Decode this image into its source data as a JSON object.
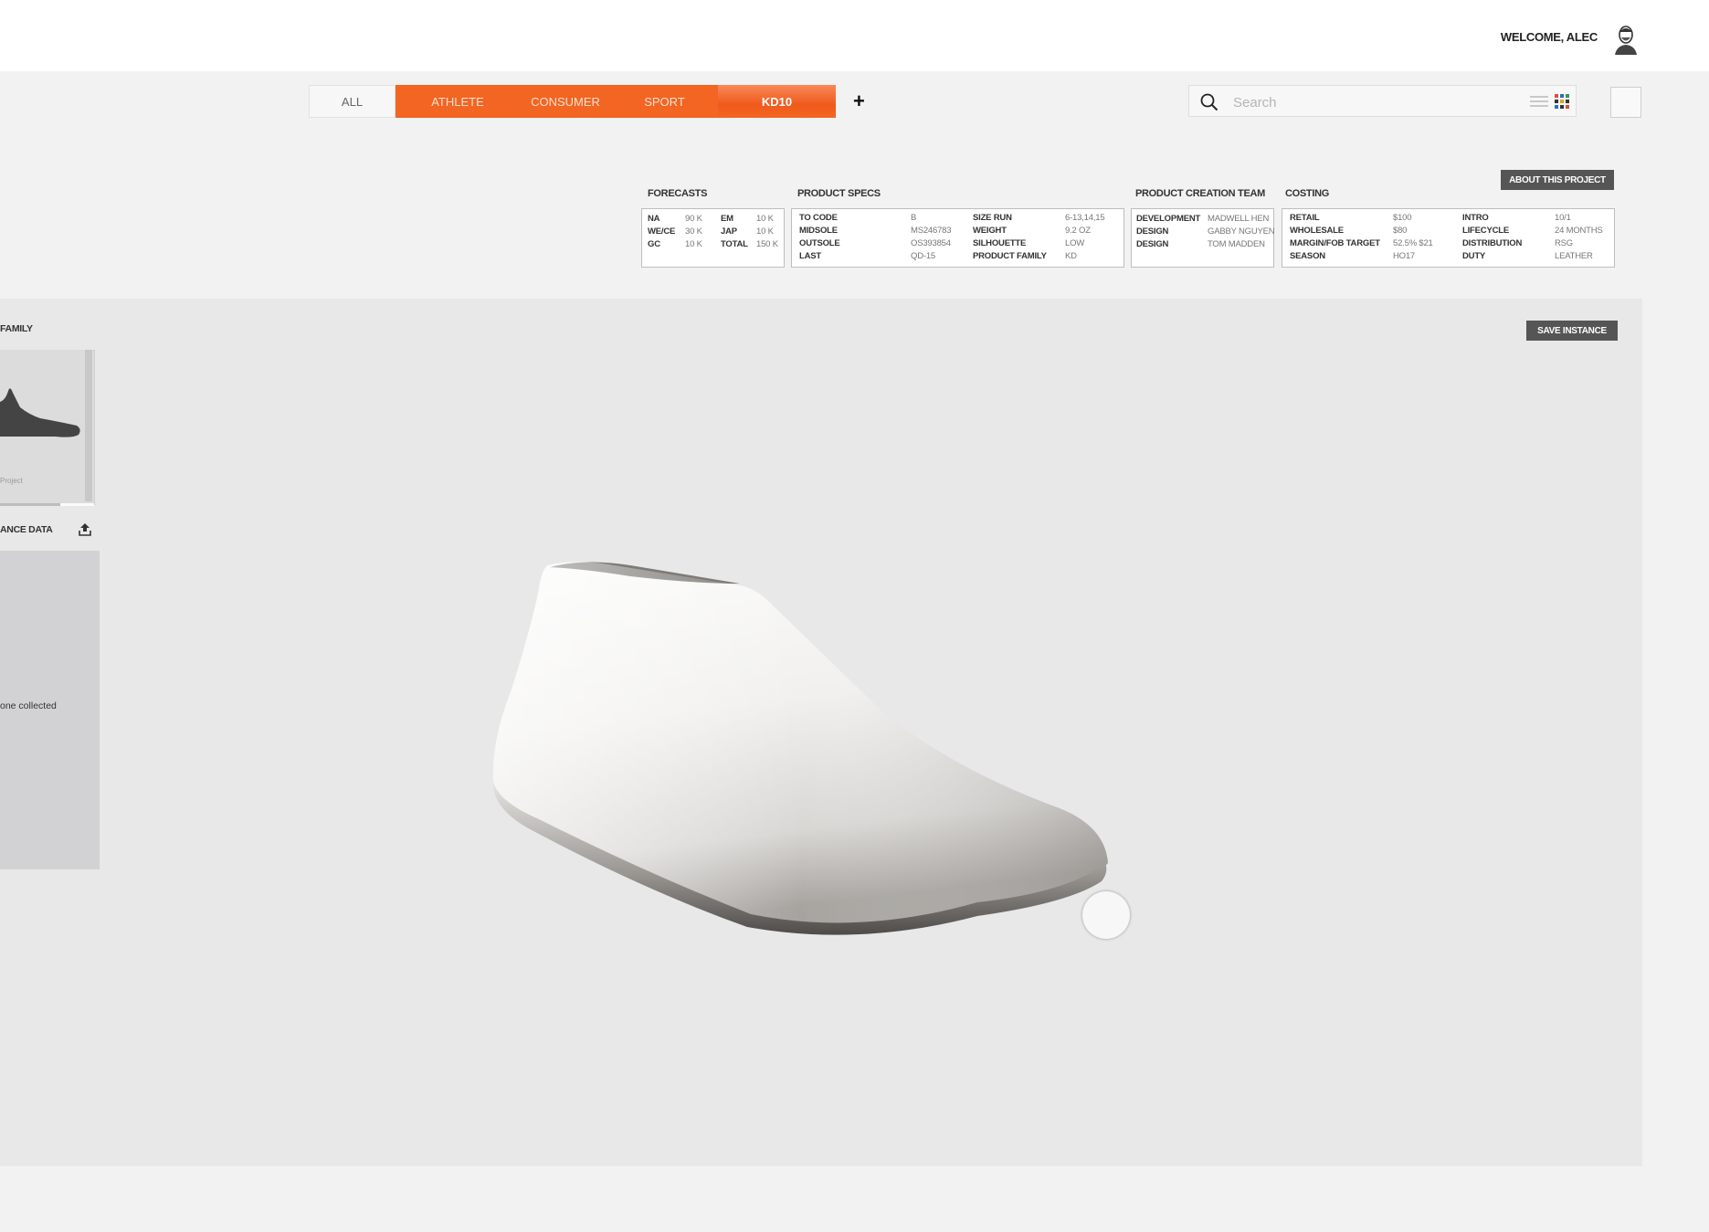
{
  "header": {
    "welcome": "WELCOME, ALEC"
  },
  "tabs": [
    "ALL",
    "ATHLETE",
    "CONSUMER",
    "SPORT",
    "KD10"
  ],
  "tab_add": "+",
  "search": {
    "placeholder": "Search",
    "value": ""
  },
  "about_button": "ABOUT THIS PROJECT",
  "forecasts": {
    "title": "FORECASTS",
    "rows": [
      [
        "NA",
        "90 K",
        "EM",
        "10 K"
      ],
      [
        "WE/CE",
        "30 K",
        "JAP",
        "10 K"
      ],
      [
        "GC",
        "10 K",
        "TOTAL",
        "150 K"
      ]
    ]
  },
  "product_specs": {
    "title": "PRODUCT SPECS",
    "rows": [
      [
        "TO CODE",
        "B",
        "SIZE RUN",
        "6-13,14,15"
      ],
      [
        "MIDSOLE",
        "MS246783",
        "WEIGHT",
        "9.2 OZ"
      ],
      [
        "OUTSOLE",
        "OS393854",
        "SILHOUETTE",
        "LOW"
      ],
      [
        "LAST",
        "QD-15",
        "PRODUCT FAMILY",
        "KD"
      ]
    ]
  },
  "team": {
    "title": "PRODUCT CREATION TEAM",
    "rows": [
      [
        "DEVELOPMENT",
        "MADWELL HEN"
      ],
      [
        "DESIGN",
        "GABBY NGUYEN"
      ],
      [
        "DESIGN",
        "TOM MADDEN"
      ]
    ]
  },
  "costing": {
    "title": "COSTING",
    "rows": [
      [
        "RETAIL",
        "$100",
        "INTRO",
        "10/1"
      ],
      [
        "WHOLESALE",
        "$80",
        "LIFECYCLE",
        "24 MONTHS"
      ],
      [
        "MARGIN/FOB TARGET",
        "52.5% $21",
        "DISTRIBUTION",
        "RSG"
      ],
      [
        "SEASON",
        "HO17",
        "DUTY",
        "LEATHER"
      ]
    ]
  },
  "viewer": {
    "family_label": "FAMILY",
    "family_card_caption": "Project",
    "performance_label": "ANCE DATA",
    "performance_empty": "one collected",
    "save_button": "SAVE INSTANCE"
  }
}
